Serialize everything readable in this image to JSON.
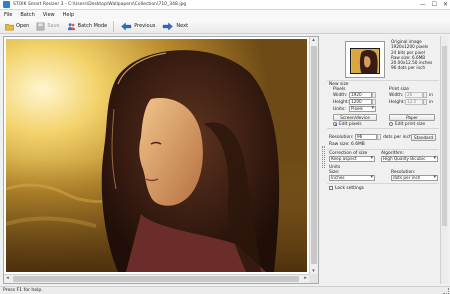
{
  "window": {
    "title": "STOIK Smart Resizer 3 - C:\\Users\\Desktop\\Wallpapers\\Collection\\710_348.jpg",
    "minimize": "—",
    "maximize": "☐",
    "close": "✕"
  },
  "menu": [
    "File",
    "Batch",
    "View",
    "Help"
  ],
  "toolbar": {
    "open": "Open",
    "save": "Save",
    "batch_mode": "Batch Mode",
    "previous": "Previous",
    "next": "Next"
  },
  "original_image": {
    "heading": "Original image",
    "pixels": "1920x1200 pixels",
    "bits": "24 bits per pixel",
    "raw_size": "Raw size: 6.6MB",
    "size_in": "20.00x12.50 inches",
    "dpi": "96 dots per inch"
  },
  "new_size": {
    "heading": "New size",
    "pixels_heading": "Pixels",
    "width_label": "Width:",
    "width_value": "1920",
    "height_label": "Height:",
    "height_value": "1200",
    "units_label": "Units:",
    "units_value": "Pixels",
    "screen_button": "Screen/device",
    "edit_pixels": "Edit pixels"
  },
  "print_size": {
    "heading": "Print size",
    "width_label": "Width:",
    "width_value": "20",
    "height_label": "Height:",
    "height_value": "12.5",
    "unit_in": "in",
    "paper_button": "Paper",
    "edit_print": "Edit print size"
  },
  "resolution": {
    "label": "Resolution:",
    "value": "96",
    "unit": "dots per inch",
    "standard_button": "Standard",
    "raw_size": "Raw size: 6.6MB"
  },
  "correction": {
    "label": "Correction of size",
    "value": "Keep aspect"
  },
  "algorithm": {
    "label": "Algorithm:",
    "value": "High Quality Bicubic"
  },
  "units": {
    "heading": "Units",
    "size_label": "Size:",
    "size_value": "Inches",
    "resolution_label": "Resolution:",
    "resolution_value": "dots per inch"
  },
  "lock_settings": "Lock settings",
  "status": "Press F1 for help.",
  "icons": {
    "open": "folder-icon",
    "save": "floppy-icon",
    "batch": "people-icon",
    "previous": "arrow-left-icon",
    "next": "arrow-right-icon"
  },
  "colors": {
    "accent": "#2a63b5",
    "photo_glow": "#f3d26a"
  }
}
